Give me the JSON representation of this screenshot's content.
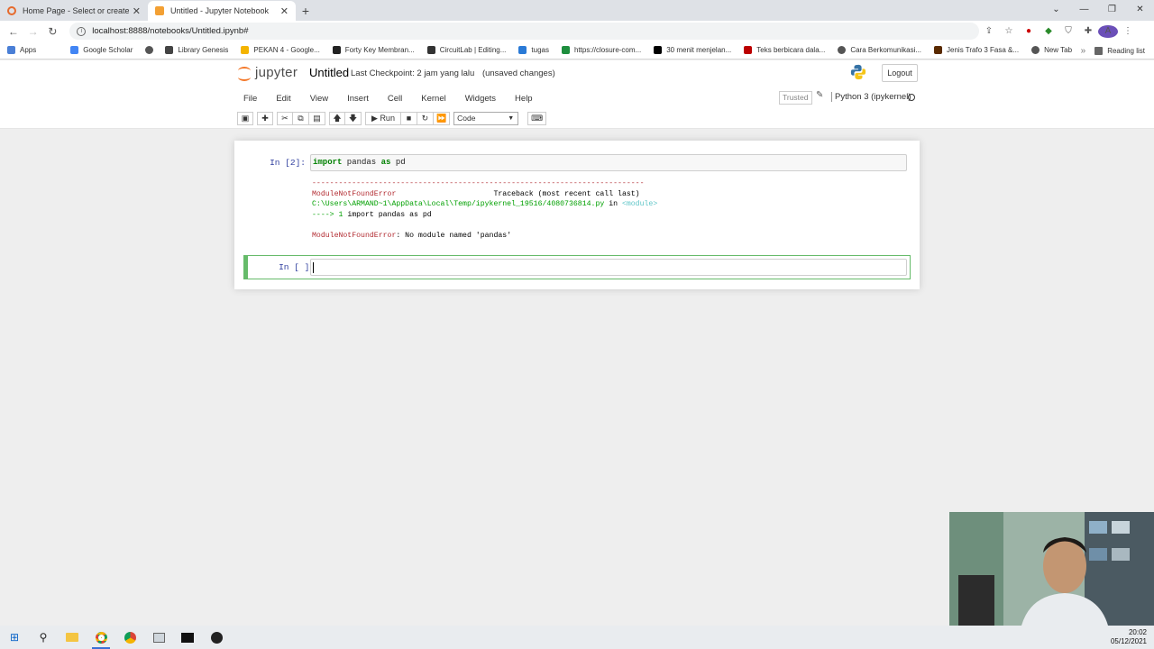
{
  "browser": {
    "tabs": [
      {
        "title": "Home Page - Select or create a n",
        "active": false
      },
      {
        "title": "Untitled - Jupyter Notebook",
        "active": true
      }
    ],
    "url": "localhost:8888/notebooks/Untitled.ipynb#",
    "bookmarks": [
      "Apps",
      "Google Scholar",
      "",
      "Library Genesis",
      "PEKAN 4 - Google...",
      "Forty Key Membran...",
      "CircuitLab | Editing...",
      "tugas",
      "https://closure-com...",
      "30 menit menjelan...",
      "Teks berbicara dala...",
      "Cara Berkomunikasi...",
      "Jenis Trafo 3 Fasa &...",
      "New Tab"
    ],
    "reading_list": "Reading list",
    "avatar_letter": "A"
  },
  "jupyter": {
    "logo_text": "jupyter",
    "notebook_name": "Untitled",
    "checkpoint": "Last Checkpoint: 2 jam yang lalu",
    "unsaved": "(unsaved changes)",
    "logout": "Logout",
    "menu": [
      "File",
      "Edit",
      "View",
      "Insert",
      "Cell",
      "Kernel",
      "Widgets",
      "Help"
    ],
    "trusted": "Trusted",
    "kernel": "Python 3 (ipykernel)",
    "toolbar": {
      "run_label": "Run",
      "cell_type": "Code"
    },
    "cells": [
      {
        "prompt": "In [2]:",
        "code_keyword": "import",
        "code_rest": " pandas ",
        "code_kw2": "as",
        "code_tail": " pd",
        "output": {
          "dashes": "---------------------------------------------------------------------------",
          "error_name": "ModuleNotFoundError",
          "traceback_label": "Traceback (most recent call last)",
          "file_path": "C:\\Users\\ARMAND~1\\AppData\\Local\\Temp/ipykernel_19516/4080736814.py",
          "in_word": " in ",
          "module": "<module>",
          "arrow_line": "----> 1",
          "arrow_code": " import pandas as pd",
          "error_msg_name": "ModuleNotFoundError",
          "error_msg": ": No module named 'pandas'"
        }
      },
      {
        "prompt": "In [ ]:"
      }
    ]
  },
  "taskbar": {
    "time": "20:02",
    "date": "05/12/2021"
  }
}
